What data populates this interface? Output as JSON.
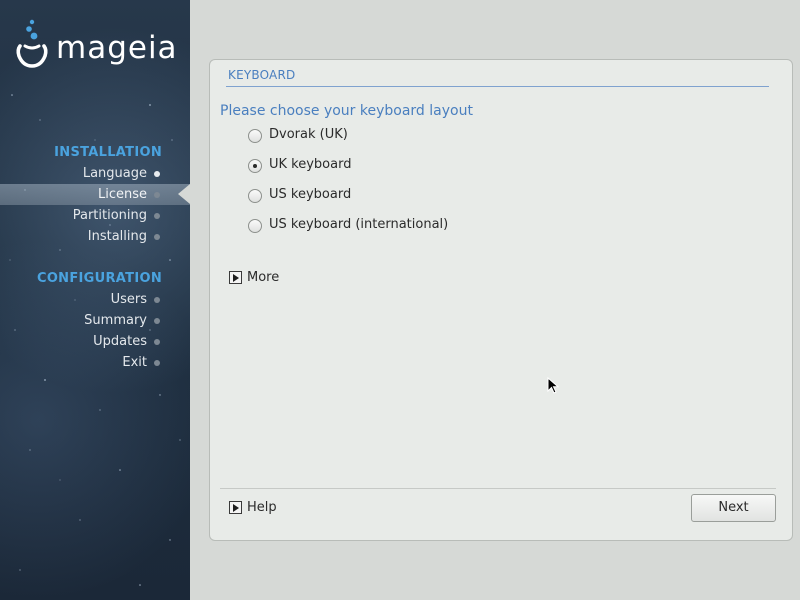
{
  "sidebar": {
    "logo_text": "mageia",
    "sections": [
      {
        "title": "INSTALLATION"
      },
      {
        "title": "CONFIGURATION"
      }
    ],
    "items": [
      {
        "label": "Language",
        "state": "done"
      },
      {
        "label": "License",
        "state": "active"
      },
      {
        "label": "Partitioning",
        "state": "pending"
      },
      {
        "label": "Installing",
        "state": "pending"
      },
      {
        "label": "Users",
        "state": "pending"
      },
      {
        "label": "Summary",
        "state": "pending"
      },
      {
        "label": "Updates",
        "state": "pending"
      },
      {
        "label": "Exit",
        "state": "pending"
      }
    ]
  },
  "main": {
    "section_title": "KEYBOARD",
    "prompt": "Please choose your keyboard layout",
    "options": [
      {
        "label": "Dvorak (UK)",
        "selected": false
      },
      {
        "label": "UK keyboard",
        "selected": true
      },
      {
        "label": "US keyboard",
        "selected": false
      },
      {
        "label": "US keyboard (international)",
        "selected": false
      }
    ],
    "more_label": "More",
    "help_label": "Help",
    "next_label": "Next"
  },
  "colors": {
    "accent": "#4a7fbf",
    "sidebar_heading": "#4aa3df",
    "sidebar_bg": "#1e2f40",
    "panel_bg": "#e8ebe8",
    "desktop_bg": "#d6d9d6"
  },
  "icons": {
    "logo": "mageia-logo-icon",
    "step_dot": "step-dot-icon",
    "expander": "expander-triangle-icon",
    "cursor": "mouse-pointer-icon"
  }
}
